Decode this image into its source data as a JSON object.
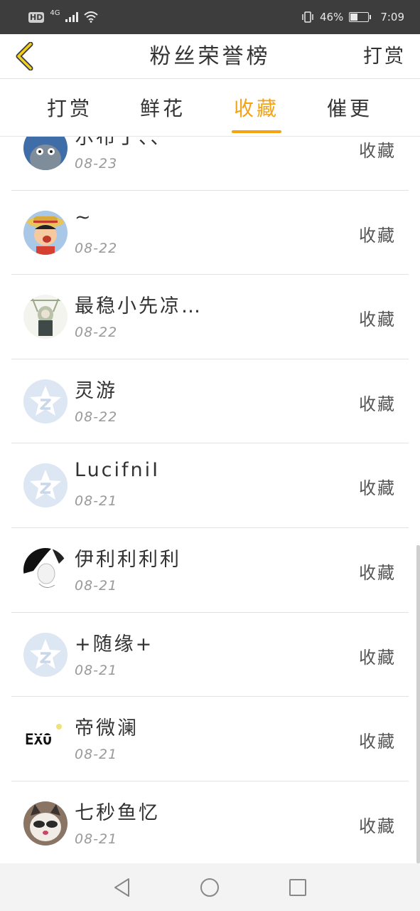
{
  "status_bar": {
    "hd": "HD",
    "network": "4G",
    "battery_text": "46%",
    "battery_level": 0.46,
    "time": "7:09"
  },
  "header": {
    "title": "粉丝荣誉榜",
    "action_label": "打赏"
  },
  "tabs": [
    {
      "label": "打赏",
      "active": false
    },
    {
      "label": "鲜花",
      "active": false
    },
    {
      "label": "收藏",
      "active": true
    },
    {
      "label": "催更",
      "active": false
    }
  ],
  "accent_color": "#f5a313",
  "fans": [
    {
      "name": "尔布丁、、",
      "date": "08-23",
      "action": "收藏",
      "avatar": "totoro-avatar"
    },
    {
      "name": "~",
      "date": "08-22",
      "action": "收藏",
      "avatar": "luffy-avatar"
    },
    {
      "name": "最稳小先凉…",
      "date": "08-22",
      "action": "收藏",
      "avatar": "anime-girl-avatar"
    },
    {
      "name": "灵游",
      "date": "08-22",
      "action": "收藏",
      "avatar": "default-avatar"
    },
    {
      "name": "LucifniI",
      "date": "08-21",
      "action": "收藏",
      "avatar": "default-avatar"
    },
    {
      "name": "伊利利利利",
      "date": "08-21",
      "action": "收藏",
      "avatar": "sketch-avatar"
    },
    {
      "name": "+随缘+",
      "date": "08-21",
      "action": "收藏",
      "avatar": "default-avatar"
    },
    {
      "name": "帝微澜",
      "date": "08-21",
      "action": "收藏",
      "avatar": "exo-avatar"
    },
    {
      "name": "七秒鱼忆",
      "date": "08-21",
      "action": "收藏",
      "avatar": "cat-avatar"
    }
  ],
  "system_nav": {
    "back": "back-icon",
    "home": "home-icon",
    "recents": "recents-icon"
  }
}
